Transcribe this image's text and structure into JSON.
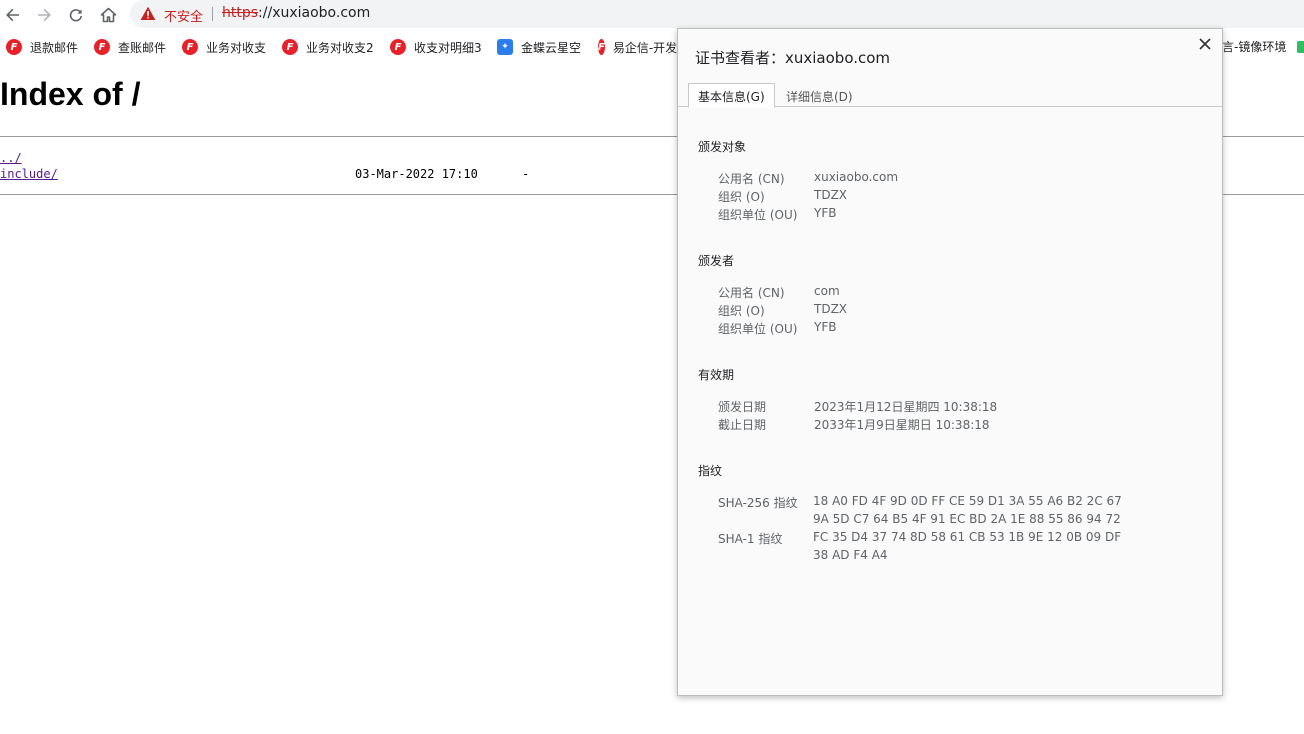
{
  "browser": {
    "security_label": "不安全",
    "url_scheme": "https",
    "url_rest": "://xuxiaobo.com",
    "bookmarks": [
      {
        "label": "退款邮件",
        "icon": "red-brand-icon"
      },
      {
        "label": "查账邮件",
        "icon": "red-brand-icon"
      },
      {
        "label": "业务对收支",
        "icon": "red-brand-icon"
      },
      {
        "label": "业务对收支2",
        "icon": "red-brand-icon"
      },
      {
        "label": "收支对明细3",
        "icon": "red-brand-icon"
      },
      {
        "label": "金蝶云星空",
        "icon": "blue-brand-icon"
      },
      {
        "label": "易企信-开发",
        "icon": "red-brand-icon"
      }
    ],
    "bookmark_overflow_label": "言-镜像环境"
  },
  "page": {
    "title": "Index of /",
    "entries": [
      {
        "name": "../",
        "date": "",
        "size": ""
      },
      {
        "name": "include/",
        "date": "03-Mar-2022 17:10",
        "size": "-"
      }
    ]
  },
  "certificate_dialog": {
    "title": "证书查看者：xuxiaobo.com",
    "tabs": [
      "基本信息(G)",
      "详细信息(D)"
    ],
    "issued_to": {
      "heading": "颁发对象",
      "fields": [
        {
          "label": "公用名 (CN)",
          "value": "xuxiaobo.com"
        },
        {
          "label": "组织 (O)",
          "value": "TDZX"
        },
        {
          "label": "组织单位 (OU)",
          "value": "YFB"
        }
      ]
    },
    "issued_by": {
      "heading": "颁发者",
      "fields": [
        {
          "label": "公用名 (CN)",
          "value": "com"
        },
        {
          "label": "组织 (O)",
          "value": "TDZX"
        },
        {
          "label": "组织单位 (OU)",
          "value": "YFB"
        }
      ]
    },
    "validity": {
      "heading": "有效期",
      "fields": [
        {
          "label": "颁发日期",
          "value": "2023年1月12日星期四 10:38:18"
        },
        {
          "label": "截止日期",
          "value": "2033年1月9日星期日 10:38:18"
        }
      ]
    },
    "fingerprints": {
      "heading": "指纹",
      "sha256_label": "SHA-256 指纹",
      "sha256_line1": "18 A0 FD 4F 9D 0D FF CE 59 D1 3A 55 A6 B2 2C 67",
      "sha256_line2": "9A 5D C7 64 B5 4F 91 EC BD 2A 1E 88 55 86 94 72",
      "sha1_label": "SHA-1 指纹",
      "sha1_line1": "FC 35 D4 37 74 8D 58 61 CB 53 1B 9E 12 0B 09 DF",
      "sha1_line2": "38 AD F4 A4"
    }
  },
  "colors": {
    "warning_red": "#c5221f",
    "link_purple": "#551a8b",
    "brand_red": "#e8202a",
    "brand_blue": "#2b7de9"
  }
}
